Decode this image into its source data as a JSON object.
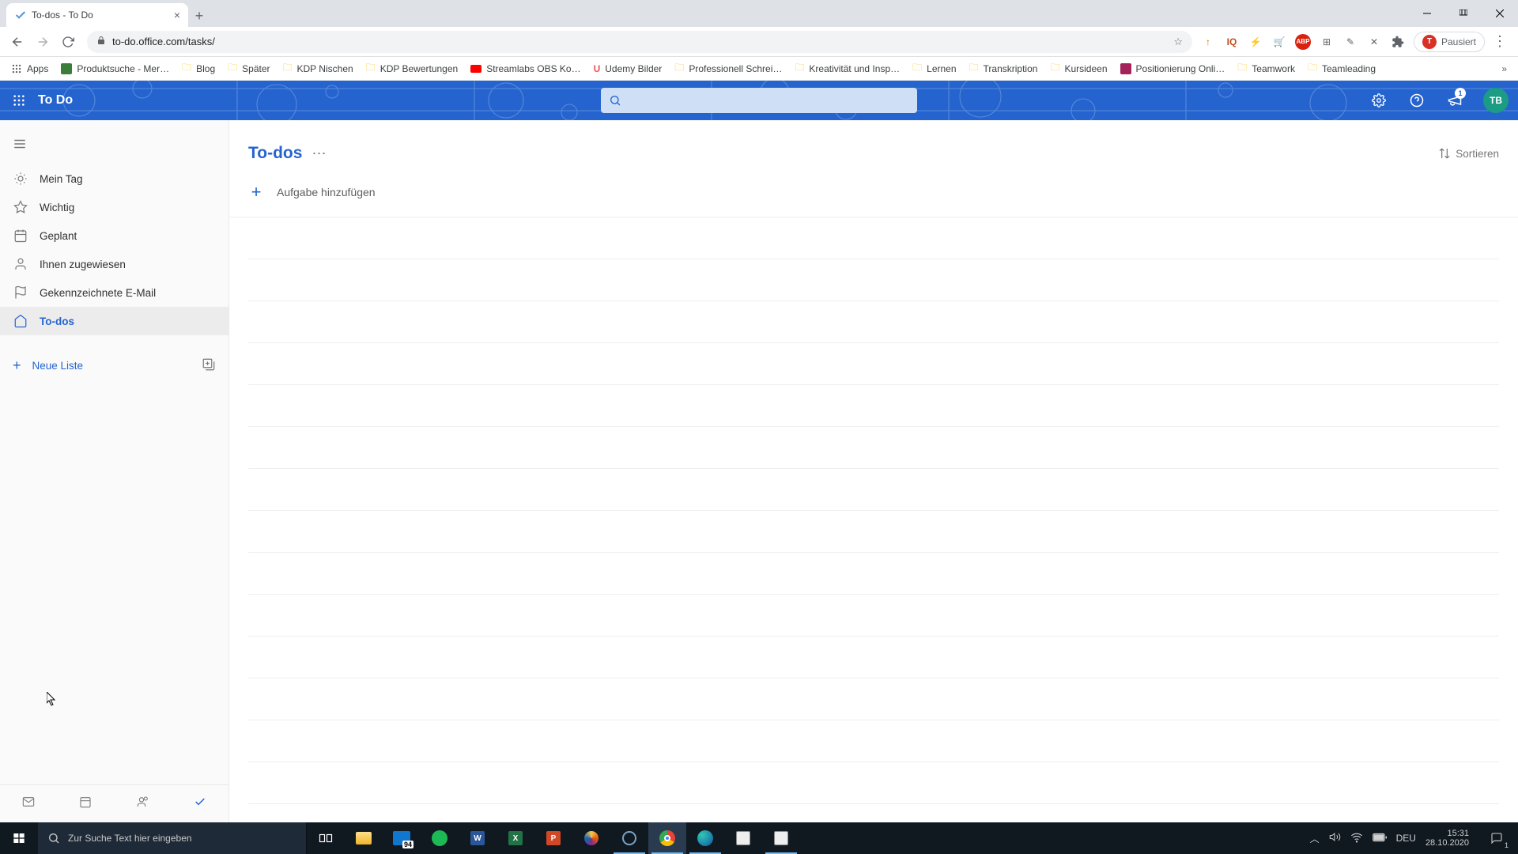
{
  "browser": {
    "tab_title": "To-dos - To Do",
    "url": "to-do.office.com/tasks/",
    "profile_letter": "T",
    "profile_status": "Pausiert",
    "bookmarks": [
      {
        "label": "Apps",
        "type": "apps"
      },
      {
        "label": "Produktsuche - Mer…",
        "type": "page"
      },
      {
        "label": "Blog",
        "type": "folder"
      },
      {
        "label": "Später",
        "type": "folder"
      },
      {
        "label": "KDP Nischen",
        "type": "folder"
      },
      {
        "label": "KDP Bewertungen",
        "type": "folder"
      },
      {
        "label": "Streamlabs OBS Ko…",
        "type": "yt"
      },
      {
        "label": "Udemy Bilder",
        "type": "udemy"
      },
      {
        "label": "Professionell Schrei…",
        "type": "folder"
      },
      {
        "label": "Kreativität und Insp…",
        "type": "folder"
      },
      {
        "label": "Lernen",
        "type": "folder"
      },
      {
        "label": "Transkription",
        "type": "folder"
      },
      {
        "label": "Kursideen",
        "type": "folder"
      },
      {
        "label": "Positionierung Onli…",
        "type": "page2"
      },
      {
        "label": "Teamwork",
        "type": "folder"
      },
      {
        "label": "Teamleading",
        "type": "folder"
      }
    ]
  },
  "header": {
    "app_name": "To Do",
    "notif_count": "1",
    "user_initials": "TB"
  },
  "sidebar": {
    "items": [
      {
        "label": "Mein Tag"
      },
      {
        "label": "Wichtig"
      },
      {
        "label": "Geplant"
      },
      {
        "label": "Ihnen zugewiesen"
      },
      {
        "label": "Gekennzeichnete E-Mail"
      },
      {
        "label": "To-dos"
      }
    ],
    "new_list": "Neue Liste"
  },
  "content": {
    "title": "To-dos",
    "add_task": "Aufgabe hinzufügen",
    "sort_label": "Sortieren",
    "empty_slots": 14
  },
  "taskbar": {
    "search_placeholder": "Zur Suche Text hier eingeben",
    "mail_badge": "94",
    "lang": "DEU",
    "time": "15:31",
    "date": "28.10.2020",
    "notif": "1"
  }
}
